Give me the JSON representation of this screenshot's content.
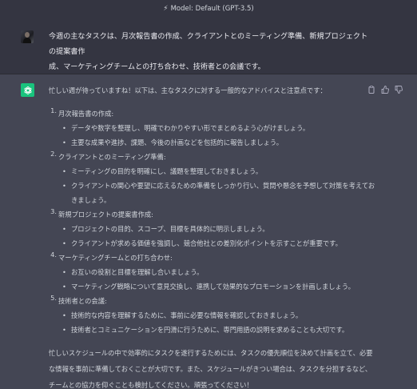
{
  "header": {
    "model_label": "Model: Default (GPT-3.5)"
  },
  "user": {
    "message": "今週の主なタスクは、月次報告書の作成、クライアントとのミーティング準備、新規プロジェクトの提案書作\n成、マーケティングチームとの打ち合わせ、技術者との会議です。"
  },
  "assistant": {
    "intro": "忙しい週が待っていますね！以下は、主なタスクに対する一般的なアドバイスと注意点です：",
    "tasks": [
      {
        "num": "1.",
        "title": "月次報告書の作成:",
        "points": [
          "データや数字を整理し、明確でわかりやすい形でまとめるよう心がけましょう。",
          "主要な成果や進捗、課題、今後の計画などを包括的に報告しましょう。"
        ]
      },
      {
        "num": "2.",
        "title": "クライアントとのミーティング準備:",
        "points": [
          "ミーティングの目的を明確にし、議題を整理しておきましょう。",
          "クライアントの関心や要望に応えるための準備をしっかり行い、質問や懸念を予想して対策を考えておきましょう。"
        ]
      },
      {
        "num": "3.",
        "title": "新規プロジェクトの提案書作成:",
        "points": [
          "プロジェクトの目的、スコープ、目標を具体的に明示しましょう。",
          "クライアントが求める価値を強調し、競合他社との差別化ポイントを示すことが重要です。"
        ]
      },
      {
        "num": "4.",
        "title": "マーケティングチームとの打ち合わせ:",
        "points": [
          "お互いの役割と目標を理解し合いましょう。",
          "マーケティング戦略について意見交換し、連携して効果的なプロモーションを計画しましょう。"
        ]
      },
      {
        "num": "5.",
        "title": "技術者との会議:",
        "points": [
          "技術的な内容を理解するために、事前に必要な情報を確認しておきましょう。",
          "技術者とコミュニケーションを円滑に行うために、専門用語の説明を求めることも大切です。"
        ]
      }
    ],
    "closing": "忙しいスケジュールの中で効率的にタスクを遂行するためには、タスクの優先順位を決めて計画を立て、必要な情報を事前に準備しておくことが大切です。また、スケジュールがきつい場合は、タスクを分担するなど、チームとの協力を仰ぐことも検討してください。頑張ってください！"
  },
  "icons": {
    "model": "bolt-icon",
    "assistant_avatar": "openai-logo-icon",
    "copy": "clipboard-icon",
    "like": "thumbs-up-icon",
    "dislike": "thumbs-down-icon"
  },
  "colors": {
    "assistant_bg": "#444654",
    "user_bg": "#343541",
    "avatar_green": "#19c37d"
  }
}
